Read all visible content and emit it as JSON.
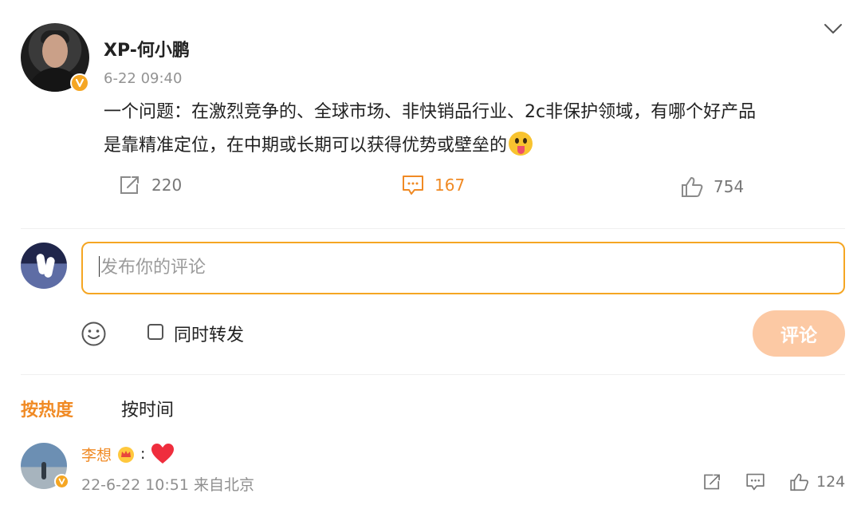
{
  "post": {
    "author": "XP-何小鹏",
    "time": "6-22 09:40",
    "content_line1": "一个问题：在激烈竞争的、全球市场、非快销品行业、2c非保护领域，有哪个好产品",
    "content_line2": "是靠精准定位，在中期或长期可以获得优势或壁垒的",
    "repost_count": "220",
    "comment_count": "167",
    "like_count": "754"
  },
  "composer": {
    "placeholder": "发布你的评论",
    "repost_label": "同时转发",
    "submit_label": "评论"
  },
  "sort": {
    "hot_label": "按热度",
    "time_label": "按时间"
  },
  "comments": [
    {
      "user": "李想",
      "separator": ":",
      "meta": "22-6-22 10:51 来自北京",
      "like_count": "124"
    }
  ],
  "icons": {
    "menu": "chevron-down-icon",
    "repost": "share-icon",
    "comment": "comment-icon",
    "like": "thumbs-up-icon",
    "emoji": "smile-icon",
    "vip": "crown-icon",
    "love": "heart-icon"
  },
  "colors": {
    "accent": "#f08a24",
    "input_border": "#f5a623",
    "submit_disabled": "#fcc9a4",
    "verified": "#f5a623",
    "muted": "#939393"
  }
}
